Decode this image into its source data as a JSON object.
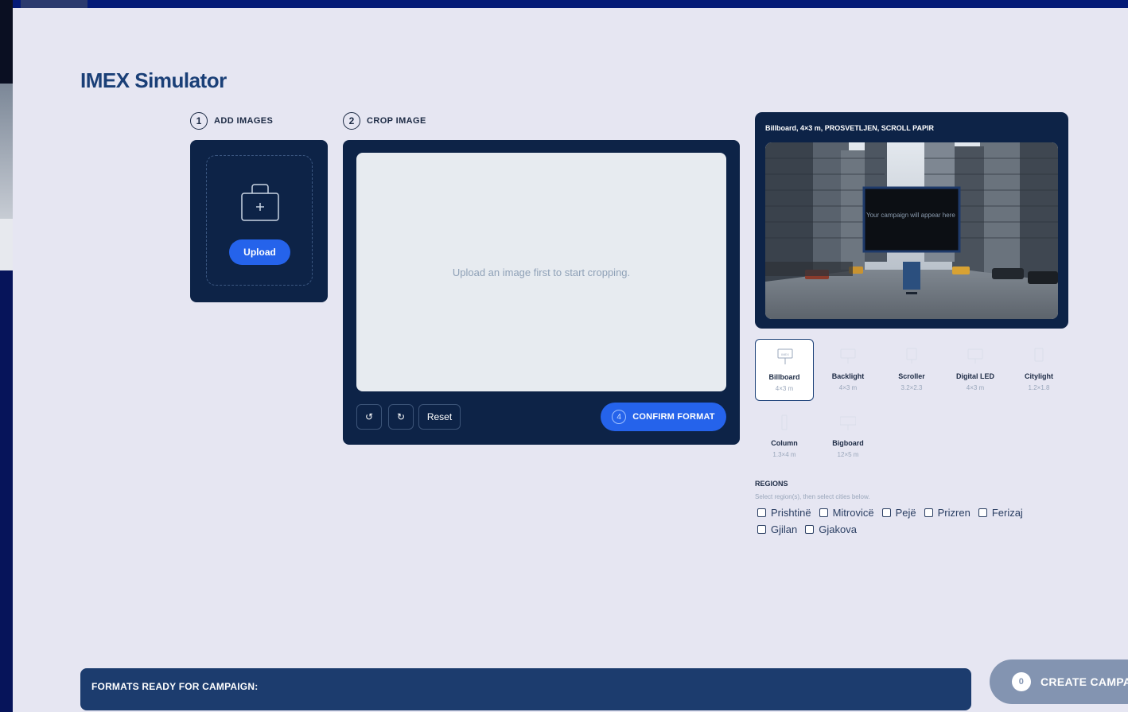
{
  "app": {
    "title": "IMEX Simulator"
  },
  "steps": [
    {
      "num": "1",
      "label": "ADD IMAGES"
    },
    {
      "num": "2",
      "label": "CROP IMAGE"
    }
  ],
  "upload": {
    "button_label": "Upload",
    "icon": "bag-plus-icon"
  },
  "crop": {
    "placeholder": "Upload an image first to start cropping.",
    "rotate_left_icon": "↺",
    "rotate_right_icon": "↻",
    "reset_label": "Reset",
    "confirm_step": "4",
    "confirm_label": "CONFIRM FORMAT"
  },
  "preview": {
    "header": "Billboard,   4×3 m,   PROSVETLJEN,   SCROLL PAPIR",
    "billboard_text": "Your campaign will appear here"
  },
  "formats": [
    {
      "name": "Billboard",
      "size": "4×3 m",
      "selected": true,
      "icon_label": "IMEX"
    },
    {
      "name": "Backlight",
      "size": "4×3 m",
      "selected": false
    },
    {
      "name": "Scroller",
      "size": "3.2×2.3",
      "selected": false
    },
    {
      "name": "Digital LED",
      "size": "4×3 m",
      "selected": false
    },
    {
      "name": "Citylight",
      "size": "1.2×1.8",
      "selected": false
    },
    {
      "name": "Column",
      "size": "1.3×4 m",
      "selected": false
    },
    {
      "name": "Bigboard",
      "size": "12×5 m",
      "selected": false
    }
  ],
  "regions": {
    "title": "REGIONS",
    "subtitle": "Select region(s), then select cities below.",
    "items": [
      "Prishtinë",
      "Mitrovicë",
      "Pejë",
      "Prizren",
      "Ferizaj",
      "Gjilan",
      "Gjakova"
    ]
  },
  "footer": {
    "formats_ready_label": "FORMATS READY FOR CAMPAIGN:",
    "create_count": "0",
    "create_label": "CREATE CAMPAIGN"
  },
  "colors": {
    "accent": "#2563eb",
    "panel": "#0d2347",
    "page_bg": "#e6e6f2",
    "title": "#1a3f77"
  }
}
